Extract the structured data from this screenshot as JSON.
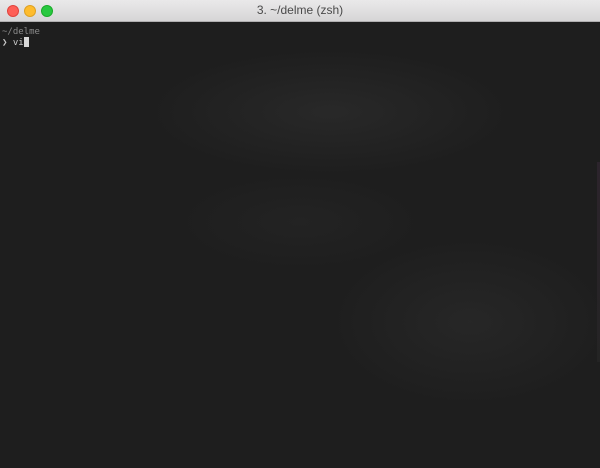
{
  "window": {
    "title": "3. ~/delme (zsh)"
  },
  "terminal": {
    "cwd_line": "~/delme",
    "prompt_symbol": "❯",
    "command": "vi"
  },
  "colors": {
    "background": "#1e1e1e",
    "titlebar": "#e0dfe0",
    "close": "#fe5f57",
    "minimize": "#febc2e",
    "zoom": "#28c840",
    "text": "#cfcfcf"
  }
}
